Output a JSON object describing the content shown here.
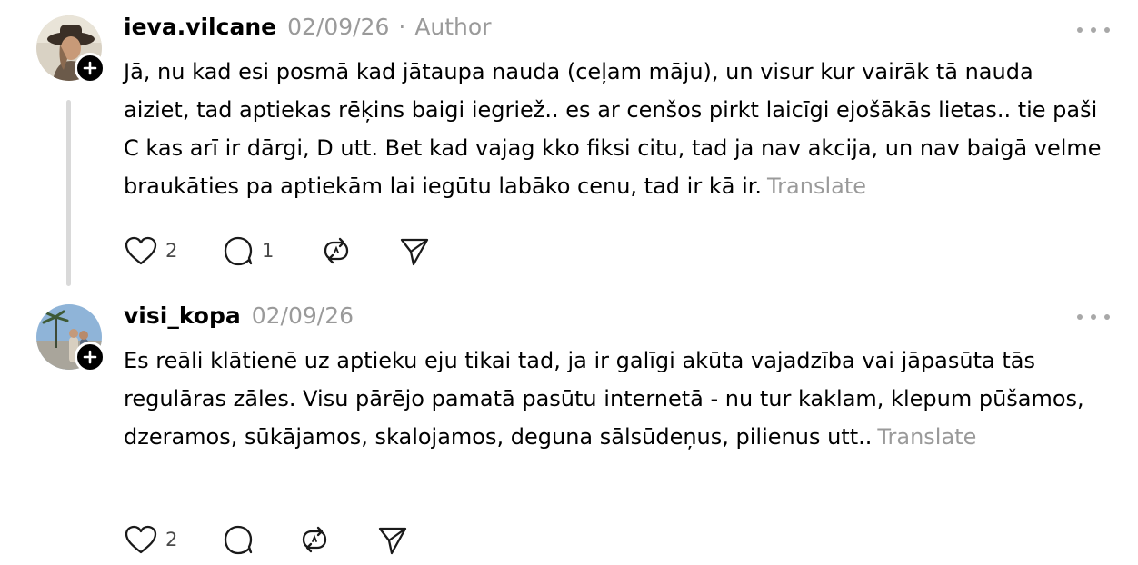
{
  "posts": [
    {
      "username": "ieva.vilcane",
      "date": "02/09/26",
      "separator": "·",
      "author_tag": "Author",
      "text": "Jā, nu kad esi posmā kad jātaupa nauda (ceļam māju), un visur kur vairāk tā nauda aiziet, tad aptiekas rēķins baigi iegriež.. es ar cenšos pirkt laicīgi ejošākās lietas.. tie paši C kas arī ir dārgi, D utt. Bet kad vajag kko fiksi citu, tad ja nav akcija, un nav baigā velme braukāties pa aptiekām lai iegūtu labāko cenu, tad ir kā ir.",
      "translate_label": "Translate",
      "like_count": "2",
      "reply_count": "1",
      "icons": [
        "heart-icon",
        "comment-icon",
        "repost-icon",
        "share-icon",
        "more-icon",
        "follow-plus-icon"
      ]
    },
    {
      "username": "visi_kopa",
      "date": "02/09/26",
      "text": "Es reāli klātienē uz aptieku eju tikai tad, ja ir galīgi akūta vajadzība vai jāpasūta tās regulāras zāles. Visu pārējo pamatā pasūtu internetā - nu tur kaklam, klepum pūšamos, dzeramos, sūkājamos, skalojamos, deguna sālsūdeņus, pilienus utt..",
      "translate_label": "Translate",
      "like_count": "2",
      "icons": [
        "heart-icon",
        "comment-icon",
        "repost-icon",
        "share-icon",
        "more-icon",
        "follow-plus-icon"
      ]
    }
  ],
  "colors": {
    "text": "#000000",
    "muted": "#9a9a9a",
    "thread_line": "#d9d9d9",
    "icon": "#1a1a1a"
  }
}
